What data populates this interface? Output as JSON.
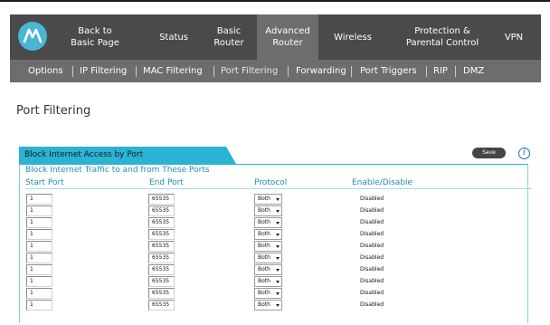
{
  "nav": {
    "items": [
      {
        "l1": "Back to",
        "l2": "Basic Page"
      },
      {
        "l1": "",
        "l2": "Status"
      },
      {
        "l1": "Basic",
        "l2": "Router"
      },
      {
        "l1": "Advanced",
        "l2": "Router"
      },
      {
        "l1": "",
        "l2": "Wireless"
      },
      {
        "l1": "Protection &",
        "l2": "Parental Control"
      },
      {
        "l1": "",
        "l2": "VPN"
      }
    ]
  },
  "subnav": {
    "items": [
      "Options",
      "IP Filtering",
      "MAC Filtering",
      "Port Filtering",
      "Forwarding",
      "Port Triggers",
      "RIP",
      "DMZ"
    ]
  },
  "page": {
    "title": "Port Filtering",
    "tab_label": "Block Internet Access by Port",
    "save_label": "Save",
    "info_symbol": "i",
    "section_title": "Block Internet Traffic to and from These Ports"
  },
  "table": {
    "headers": [
      "Start Port",
      "End Port",
      "Protocol",
      "Enable/Disable"
    ],
    "rows": [
      {
        "start": "1",
        "end": "65535",
        "protocol": "Both",
        "status": "Disabled"
      },
      {
        "start": "1",
        "end": "65535",
        "protocol": "Both",
        "status": "Disabled"
      },
      {
        "start": "1",
        "end": "65535",
        "protocol": "Both",
        "status": "Disabled"
      },
      {
        "start": "1",
        "end": "65535",
        "protocol": "Both",
        "status": "Disabled"
      },
      {
        "start": "1",
        "end": "65535",
        "protocol": "Both",
        "status": "Disabled"
      },
      {
        "start": "1",
        "end": "65535",
        "protocol": "Both",
        "status": "Disabled"
      },
      {
        "start": "1",
        "end": "65535",
        "protocol": "Both",
        "status": "Disabled"
      },
      {
        "start": "1",
        "end": "65535",
        "protocol": "Both",
        "status": "Disabled"
      },
      {
        "start": "1",
        "end": "65535",
        "protocol": "Both",
        "status": "Disabled"
      },
      {
        "start": "1",
        "end": "65535",
        "protocol": "Both",
        "status": "Disabled"
      }
    ]
  },
  "colors": {
    "nav_bg": "#4a4a4a",
    "active_bg": "#6d6d6d",
    "accent": "#2bb3d3",
    "heading_blue": "#1e8fb3"
  },
  "icons": {
    "logo": "motorola-logo",
    "info": "info-icon",
    "dropdown": "chevron-down-icon"
  }
}
